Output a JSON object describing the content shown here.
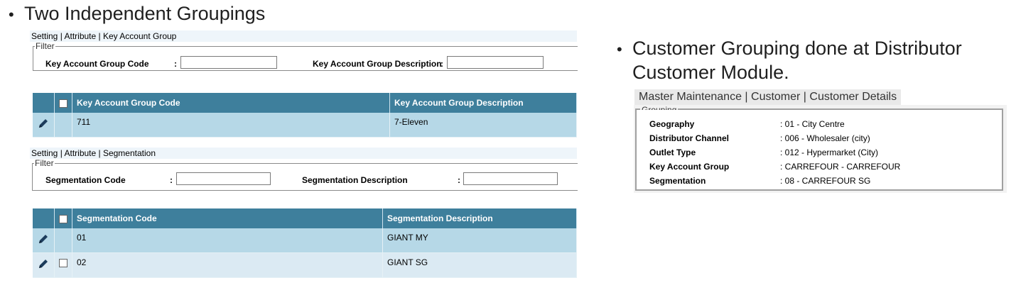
{
  "left_bullet": "Two Independent Groupings",
  "right_bullet_line1": "Customer Grouping done at Distributor",
  "right_bullet_line2": "Customer Module.",
  "kag": {
    "breadcrumb": "Setting | Attribute | Key Account Group",
    "filter_legend": "Filter",
    "code_label": "Key Account Group Code",
    "desc_label": "Key Account Group Description",
    "colon": ":",
    "columns": [
      "Key Account Group Code",
      "Key Account Group Description"
    ],
    "rows": [
      {
        "code": "711",
        "desc": "7-Eleven"
      }
    ]
  },
  "seg": {
    "breadcrumb": "Setting | Attribute | Segmentation",
    "filter_legend": "Filter",
    "code_label": "Segmentation Code",
    "desc_label": "Segmentation Description",
    "colon": ":",
    "columns": [
      "Segmentation Code",
      "Segmentation Description"
    ],
    "rows": [
      {
        "code": "01",
        "desc": "GIANT MY"
      },
      {
        "code": "02",
        "desc": "GIANT SG"
      }
    ]
  },
  "customer": {
    "breadcrumb": "Master Maintenance | Customer | Customer Details",
    "legend": "Grouping",
    "fields": [
      {
        "key": "Geography",
        "value": ": 01 - City Centre"
      },
      {
        "key": "Distributor Channel",
        "value": ": 006 - Wholesaler (city)"
      },
      {
        "key": "Outlet Type",
        "value": ": 012 - Hypermarket (City)"
      },
      {
        "key": "Key Account Group",
        "value": ": CARREFOUR - CARREFOUR"
      },
      {
        "key": "Segmentation",
        "value": ": 08 - CARREFOUR SG"
      }
    ]
  },
  "icons": {
    "edit": "pencil-icon",
    "checkbox": "checkbox-icon",
    "bullet": "bullet-dot"
  },
  "colors": {
    "header": "#3e7f9c",
    "row": "#b6d8e7",
    "row_alt": "#dbeaf3"
  }
}
